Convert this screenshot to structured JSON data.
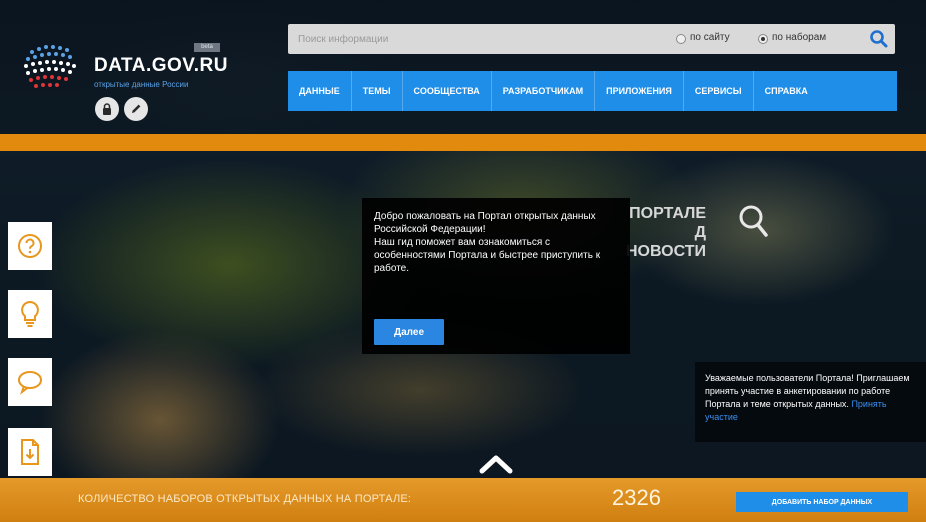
{
  "header": {
    "brand": "DATA.GOV.RU",
    "brand_subtitle": "открытые данные России",
    "beta_tag": "beta",
    "search": {
      "placeholder": "Поиск информации",
      "scope_site_label": "по сайту",
      "scope_datasets_label": "по наборам",
      "selected_scope": "по наборам"
    },
    "nav": [
      "ДАННЫЕ",
      "ТЕМЫ",
      "СООБЩЕСТВА",
      "РАЗРАБОТЧИКАМ",
      "ПРИЛОЖЕНИЯ",
      "СЕРВИСЫ",
      "СПРАВКА"
    ]
  },
  "hero": {
    "title": "ПОРТАЛЕ\nД\nНОВОСТИ"
  },
  "popup": {
    "text": "Добро пожаловать на Портал открытых данных Российской Федерации!\nНаш гид поможет вам ознакомиться с особенностями Портала и быстрее приступить к работе.",
    "button_label": "Далее"
  },
  "notice": {
    "text": "Уважаемые пользователи Портала! Приглашаем принять участие в анкетировании по работе Портала и теме открытых данных.",
    "link_label": "Принять участие"
  },
  "footer": {
    "count_label": "КОЛИЧЕСТВО НАБОРОВ ОТКРЫТЫХ ДАННЫХ НА ПОРТАЛЕ:",
    "count_value": "2326",
    "add_button_label": "ДОБАВИТЬ НАБОР ДАННЫХ"
  },
  "colors": {
    "accent_blue": "#1f8ee8",
    "accent_orange": "#e28a0e"
  },
  "icons": {
    "side_buttons": [
      "question-icon",
      "lightbulb-icon",
      "speech-bubble-icon",
      "document-upload-icon"
    ],
    "header_buttons": [
      "lock-icon",
      "pencil-icon"
    ]
  }
}
